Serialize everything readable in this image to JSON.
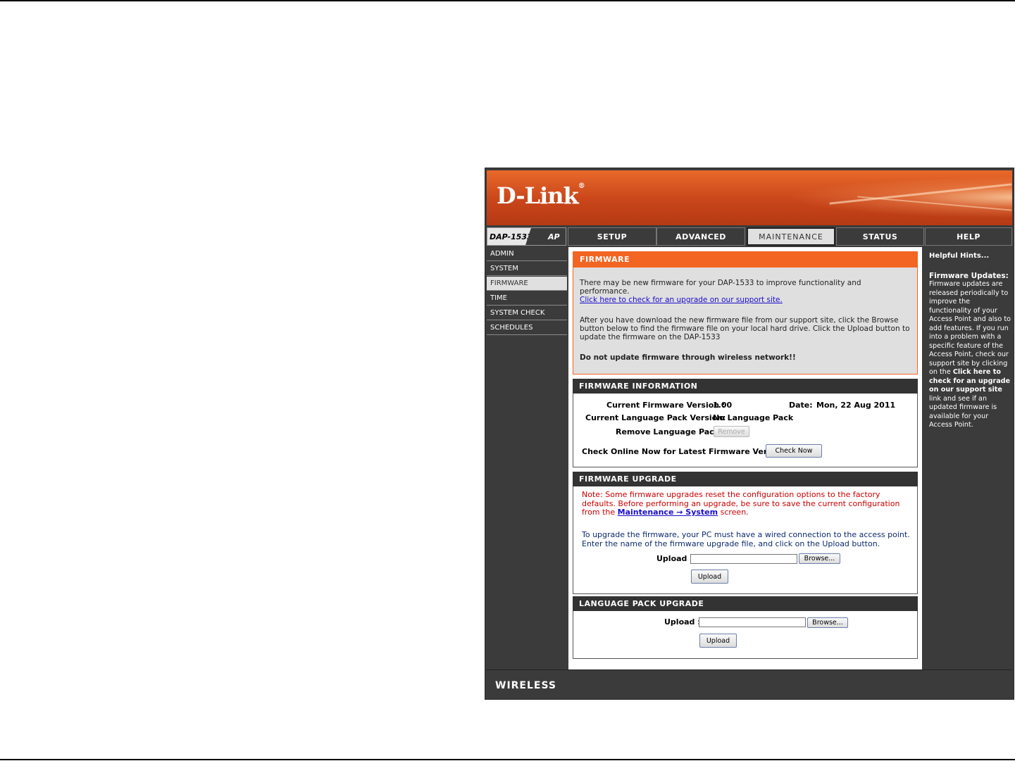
{
  "brand": {
    "logo": "D-Link",
    "reg_mark": "®",
    "model": "DAP-1533",
    "mode": "AP",
    "footer": "WIRELESS"
  },
  "tabs": [
    {
      "label": "SETUP"
    },
    {
      "label": "ADVANCED"
    },
    {
      "label": "MAINTENANCE",
      "active": true
    },
    {
      "label": "STATUS"
    },
    {
      "label": "HELP"
    }
  ],
  "nav": [
    {
      "label": "ADMIN"
    },
    {
      "label": "SYSTEM"
    },
    {
      "label": "FIRMWARE",
      "active": true
    },
    {
      "label": "TIME"
    },
    {
      "label": "SYSTEM CHECK"
    },
    {
      "label": "SCHEDULES"
    }
  ],
  "firmware": {
    "title": "FIRMWARE",
    "intro": "There may be new firmware for your DAP-1533 to improve functionality and performance.",
    "check_link": "Click here to check for an upgrade on our support site.",
    "instructions": "After you have download the new firmware file from our support site, click the Browse button below to find the firmware file on your local hard drive. Click the Upload button to update the firmware on the DAP-1533",
    "warning": "Do not update firmware through wireless network!!"
  },
  "info": {
    "title": "FIRMWARE INFORMATION",
    "current_version_label": "Current Firmware Version :",
    "current_version": "1.00",
    "date_label": "Date:",
    "date": "Mon, 22 Aug 2011",
    "lang_pack_label": "Current Language Pack Version:",
    "lang_pack": "No Language Pack",
    "remove_label": "Remove Language Pack:",
    "remove_button": "Remove",
    "check_online_label": "Check Online Now for Latest Firmware Version:",
    "check_now_button": "Check Now"
  },
  "upgrade": {
    "title": "FIRMWARE UPGRADE",
    "note_prefix": "Note: Some firmware upgrades reset the configuration options to the factory defaults. Before performing an upgrade, be sure to save the current configuration from the",
    "note_link": "Maintenance → System",
    "note_suffix": "screen.",
    "instructions": "To upgrade the firmware, your PC must have a wired connection to the access point. Enter the name of the firmware upgrade file, and click on the Upload button.",
    "upload_label": "Upload :",
    "browse_button": "Browse...",
    "upload_button": "Upload"
  },
  "lang_upgrade": {
    "title": "LANGUAGE PACK UPGRADE",
    "upload_label": "Upload :",
    "browse_button": "Browse...",
    "upload_button": "Upload"
  },
  "help": {
    "title": "Helpful Hints...",
    "subtitle": "Firmware Updates:",
    "body_prefix": "Firmware updates are released periodically to improve the functionality of your Access Point and also to add features. If you run into a problem with a specific feature of the Access Point, check our support site by clicking on the",
    "body_bold": "Click here to check for an upgrade on our support site",
    "body_suffix": "link and see if an updated firmware is available for your Access Point."
  },
  "colors": {
    "accent": "#f26522",
    "dark": "#3b3b3b",
    "banner": "#c9451a",
    "note_red": "#cc0000"
  }
}
